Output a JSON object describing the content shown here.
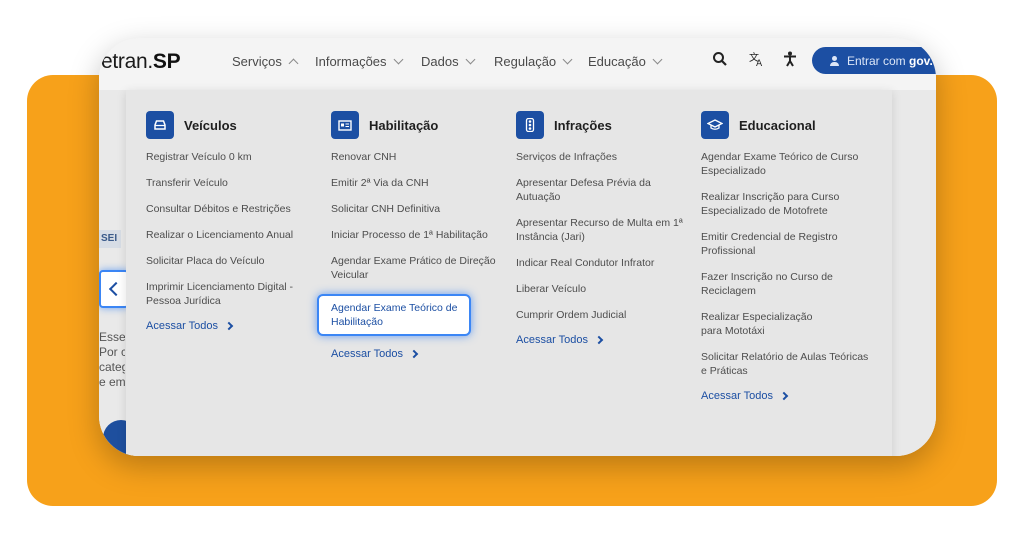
{
  "header": {
    "logo_text": "etran.",
    "logo_bold": "SP",
    "nav": [
      {
        "label": "Serviços",
        "expanded": true
      },
      {
        "label": "Informações",
        "expanded": false
      },
      {
        "label": "Dados",
        "expanded": false
      },
      {
        "label": "Regulação",
        "expanded": false
      },
      {
        "label": "Educação",
        "expanded": false
      }
    ],
    "login_label": "Entrar com ",
    "login_bold": "gov.br"
  },
  "background": {
    "chip": "SEI",
    "text_lines": [
      "Esse",
      "Por c",
      "categ",
      "e em"
    ]
  },
  "menu": {
    "columns": [
      {
        "title": "Veículos",
        "icon": "car-icon",
        "links": [
          "Registrar Veículo 0 km",
          "Transferir Veículo",
          "Consultar Débitos e Restrições",
          "Realizar o Licenciamento Anual",
          "Solicitar Placa do Veículo",
          "Imprimir Licenciamento Digital - Pessoa Jurídica"
        ],
        "access_label": "Acessar Todos"
      },
      {
        "title": "Habilitação",
        "icon": "id-card-icon",
        "links": [
          "Renovar CNH",
          "Emitir 2ª Via da CNH",
          "Solicitar CNH Definitiva",
          "Iniciar Processo de 1ª Habilitação",
          "Agendar Exame Prático de Direção Veicular",
          "Agendar Exame Teórico de Habilitação"
        ],
        "highlighted_index": 5,
        "access_label": "Acessar Todos"
      },
      {
        "title": "Infrações",
        "icon": "traffic-light-icon",
        "links": [
          "Serviços de Infrações",
          "Apresentar Defesa Prévia da Autuação",
          "Apresentar Recurso de Multa em 1ª Instância (Jari)",
          "Indicar Real Condutor Infrator",
          "Liberar Veículo",
          "Cumprir Ordem Judicial"
        ],
        "access_label": "Acessar Todos"
      },
      {
        "title": "Educacional",
        "icon": "graduation-cap-icon",
        "links": [
          "Agendar Exame Teórico de Curso Especializado",
          "Realizar Inscrição para Curso Especializado de Motofrete",
          "Emitir Credencial de Registro Profissional",
          "Fazer Inscrição no Curso de Reciclagem",
          "Realizar Especialização para Mototáxi",
          "Solicitar Relatório de Aulas Teóricas e Práticas"
        ],
        "access_label": "Acessar Todos"
      }
    ]
  },
  "colors": {
    "accent": "#1c4fa3",
    "frame_background": "#f7a11a",
    "focus_glow": "#3b86f5"
  }
}
